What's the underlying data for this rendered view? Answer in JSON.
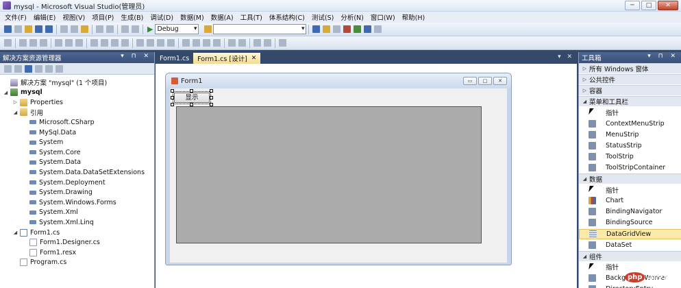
{
  "window": {
    "title": "mysql - Microsoft Visual Studio(管理员)",
    "minimize": "─",
    "maximize": "□",
    "close": "✕"
  },
  "menu": [
    "文件(F)",
    "编辑(E)",
    "视图(V)",
    "项目(P)",
    "生成(B)",
    "调试(D)",
    "数据(M)",
    "数据(A)",
    "工具(T)",
    "体系结构(C)",
    "测试(S)",
    "分析(N)",
    "窗口(W)",
    "帮助(H)"
  ],
  "toolbar": {
    "config": "Debug",
    "target": ""
  },
  "solution_explorer": {
    "title": "解决方案资源管理器",
    "pins": "▾ ⊓ ✕",
    "items": [
      {
        "label": "解决方案 \"mysql\" (1 个项目)",
        "icon": "solution",
        "level": 0,
        "toggle": ""
      },
      {
        "label": "mysql",
        "icon": "project",
        "level": 0,
        "toggle": "◢",
        "bold": true
      },
      {
        "label": "Properties",
        "icon": "folder",
        "level": 1,
        "toggle": "▷"
      },
      {
        "label": "引用",
        "icon": "folder",
        "level": 1,
        "toggle": "◢"
      },
      {
        "label": "Microsoft.CSharp",
        "icon": "reference",
        "level": 2,
        "toggle": ""
      },
      {
        "label": "MySql.Data",
        "icon": "reference",
        "level": 2,
        "toggle": ""
      },
      {
        "label": "System",
        "icon": "reference",
        "level": 2,
        "toggle": ""
      },
      {
        "label": "System.Core",
        "icon": "reference",
        "level": 2,
        "toggle": ""
      },
      {
        "label": "System.Data",
        "icon": "reference",
        "level": 2,
        "toggle": ""
      },
      {
        "label": "System.Data.DataSetExtensions",
        "icon": "reference",
        "level": 2,
        "toggle": ""
      },
      {
        "label": "System.Deployment",
        "icon": "reference",
        "level": 2,
        "toggle": ""
      },
      {
        "label": "System.Drawing",
        "icon": "reference",
        "level": 2,
        "toggle": ""
      },
      {
        "label": "System.Windows.Forms",
        "icon": "reference",
        "level": 2,
        "toggle": ""
      },
      {
        "label": "System.Xml",
        "icon": "reference",
        "level": 2,
        "toggle": ""
      },
      {
        "label": "System.Xml.Linq",
        "icon": "reference",
        "level": 2,
        "toggle": ""
      },
      {
        "label": "Form1.cs",
        "icon": "form",
        "level": 1,
        "toggle": "◢"
      },
      {
        "label": "Form1.Designer.cs",
        "icon": "file",
        "level": 2,
        "toggle": ""
      },
      {
        "label": "Form1.resx",
        "icon": "file",
        "level": 2,
        "toggle": ""
      },
      {
        "label": "Program.cs",
        "icon": "file",
        "level": 1,
        "toggle": ""
      }
    ]
  },
  "tabs": [
    {
      "label": "Form1.cs",
      "active": false,
      "close": ""
    },
    {
      "label": "Form1.cs [设计]",
      "active": true,
      "close": "✕"
    }
  ],
  "designer": {
    "form_title": "Form1",
    "button_label": "显示",
    "form_min": "▭",
    "form_max": "□",
    "form_close": "✕"
  },
  "toolbox": {
    "title": "工具箱",
    "pins": "▾ ⊓ ✕",
    "rows": [
      {
        "type": "cat",
        "label": "所有 Windows 窗体",
        "toggle": "▷"
      },
      {
        "type": "cat",
        "label": "公共控件",
        "toggle": "▷"
      },
      {
        "type": "cat",
        "label": "容器",
        "toggle": "▷"
      },
      {
        "type": "cat",
        "label": "菜单和工具栏",
        "toggle": "◢"
      },
      {
        "type": "item",
        "label": "指针",
        "icon": "pointer"
      },
      {
        "type": "item",
        "label": "ContextMenuStrip",
        "icon": "tool"
      },
      {
        "type": "item",
        "label": "MenuStrip",
        "icon": "tool"
      },
      {
        "type": "item",
        "label": "StatusStrip",
        "icon": "tool"
      },
      {
        "type": "item",
        "label": "ToolStrip",
        "icon": "tool"
      },
      {
        "type": "item",
        "label": "ToolStripContainer",
        "icon": "tool"
      },
      {
        "type": "cat",
        "label": "数据",
        "toggle": "◢"
      },
      {
        "type": "item",
        "label": "指针",
        "icon": "pointer"
      },
      {
        "type": "item",
        "label": "Chart",
        "icon": "chart"
      },
      {
        "type": "item",
        "label": "BindingNavigator",
        "icon": "tool"
      },
      {
        "type": "item",
        "label": "BindingSource",
        "icon": "tool"
      },
      {
        "type": "item",
        "label": "DataGridView",
        "icon": "grid",
        "selected": true
      },
      {
        "type": "item",
        "label": "DataSet",
        "icon": "tool"
      },
      {
        "type": "cat",
        "label": "组件",
        "toggle": "◢"
      },
      {
        "type": "item",
        "label": "指针",
        "icon": "pointer"
      },
      {
        "type": "item",
        "label": "BackgroundWorker",
        "icon": "tool"
      },
      {
        "type": "item",
        "label": "DirectoryEntry",
        "icon": "tool"
      }
    ]
  },
  "watermark": {
    "brand": "php",
    "site": "中文网"
  }
}
